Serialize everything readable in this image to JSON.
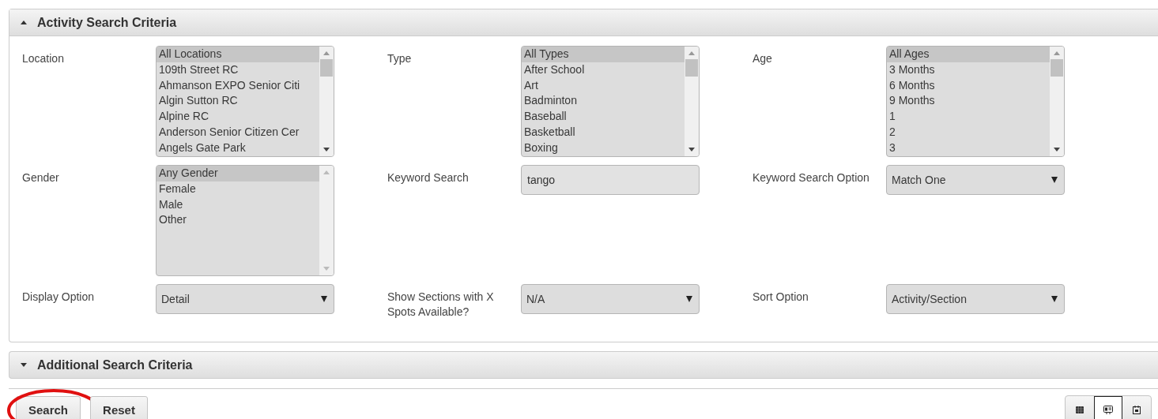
{
  "activity_panel": {
    "title": "Activity Search Criteria",
    "expanded": true,
    "rows": [
      [
        {
          "label": "Location",
          "kind": "listbox",
          "options": [
            {
              "text": "All Locations",
              "selected": true
            },
            {
              "text": "109th Street RC",
              "selected": false
            },
            {
              "text": "Ahmanson EXPO Senior Citi",
              "selected": false
            },
            {
              "text": "Algin Sutton RC",
              "selected": false
            },
            {
              "text": "Alpine RC",
              "selected": false
            },
            {
              "text": "Anderson Senior Citizen Cer",
              "selected": false
            },
            {
              "text": "Angels Gate Park",
              "selected": false
            }
          ]
        },
        {
          "label": "Type",
          "kind": "listbox",
          "options": [
            {
              "text": "All Types",
              "selected": true
            },
            {
              "text": "After School",
              "selected": false
            },
            {
              "text": "Art",
              "selected": false
            },
            {
              "text": "Badminton",
              "selected": false
            },
            {
              "text": "Baseball",
              "selected": false
            },
            {
              "text": "Basketball",
              "selected": false
            },
            {
              "text": "Boxing",
              "selected": false
            }
          ]
        },
        {
          "label": "Age",
          "kind": "listbox",
          "options": [
            {
              "text": "All Ages",
              "selected": true
            },
            {
              "text": "3 Months",
              "selected": false
            },
            {
              "text": "6 Months",
              "selected": false
            },
            {
              "text": "9 Months",
              "selected": false
            },
            {
              "text": "1",
              "selected": false
            },
            {
              "text": "2",
              "selected": false
            },
            {
              "text": "3",
              "selected": false
            }
          ]
        }
      ],
      [
        {
          "label": "Gender",
          "kind": "listbox",
          "options": [
            {
              "text": "Any Gender",
              "selected": true
            },
            {
              "text": "Female",
              "selected": false
            },
            {
              "text": "Male",
              "selected": false
            },
            {
              "text": "Other",
              "selected": false
            }
          ]
        },
        {
          "label": "Keyword Search",
          "kind": "text",
          "value": "tango"
        },
        {
          "label": "Keyword Search Option",
          "kind": "select",
          "value": "Match One"
        }
      ],
      [
        {
          "label": "Display Option",
          "kind": "select",
          "value": "Detail"
        },
        {
          "label": "Show Sections with X Spots Available?",
          "kind": "select",
          "value": "N/A"
        },
        {
          "label": "Sort Option",
          "kind": "select",
          "value": "Activity/Section"
        }
      ]
    ]
  },
  "additional_panel": {
    "title": "Additional Search Criteria",
    "expanded": false
  },
  "buttons": [
    {
      "label": "Search",
      "highlighted": true
    },
    {
      "label": "Reset",
      "highlighted": false
    }
  ],
  "view_buttons": [
    {
      "kind": "grid",
      "selected": false
    },
    {
      "kind": "card",
      "selected": true
    },
    {
      "kind": "calendar",
      "selected": false
    }
  ]
}
